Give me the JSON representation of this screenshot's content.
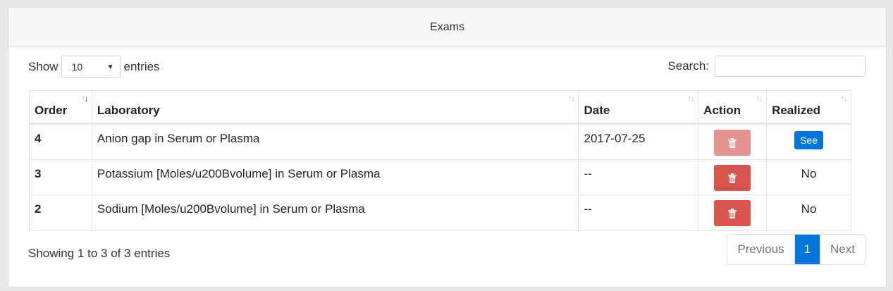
{
  "panel": {
    "title": "Exams"
  },
  "length": {
    "prefix": "Show",
    "value": "10",
    "suffix": "entries"
  },
  "search": {
    "label": "Search:",
    "value": "",
    "placeholder": ""
  },
  "table": {
    "columns": [
      "Order",
      "Laboratory",
      "Date",
      "Action",
      "Realized"
    ],
    "rows": [
      {
        "order": "4",
        "laboratory": "Anion gap in Serum or Plasma",
        "date": "2017-07-25",
        "action_disabled": true,
        "realized": "See"
      },
      {
        "order": "3",
        "laboratory": "Potassium [Moles/u200Bvolume] in Serum or Plasma",
        "date": "--",
        "action_disabled": false,
        "realized": "No"
      },
      {
        "order": "2",
        "laboratory": "Sodium [Moles/u200Bvolume] in Serum or Plasma",
        "date": "--",
        "action_disabled": false,
        "realized": "No"
      }
    ]
  },
  "info": "Showing 1 to 3 of 3 entries",
  "pagination": {
    "previous": "Previous",
    "current": "1",
    "next": "Next"
  },
  "icons": {
    "delete": "trash-icon",
    "sort": "sort-icon",
    "caret": "caret-down-icon"
  },
  "colors": {
    "primary": "#0275d8",
    "danger": "#d9534f",
    "danger_disabled": "#e49391"
  }
}
